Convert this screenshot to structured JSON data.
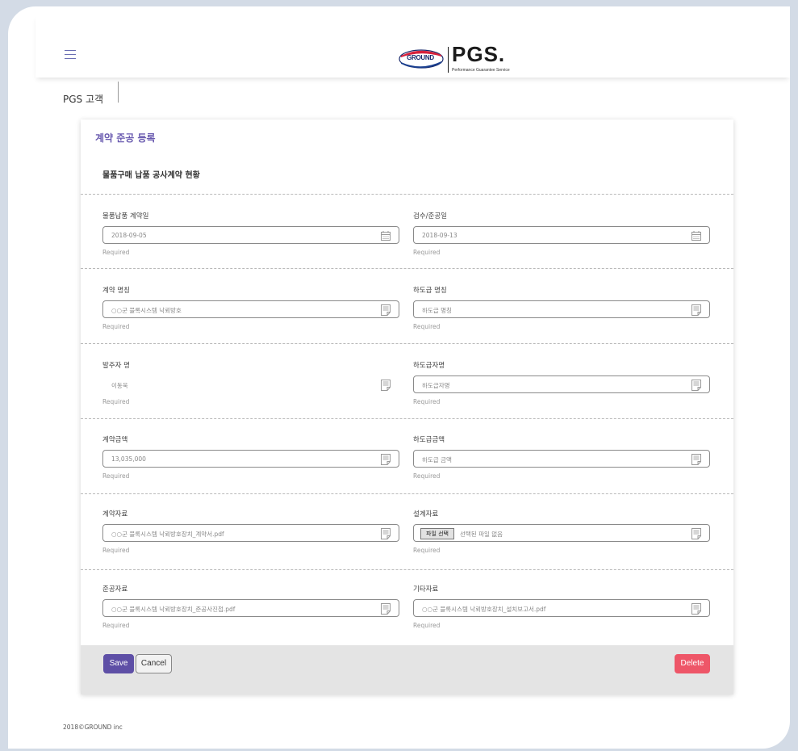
{
  "header": {
    "logo_ground": "GROUND",
    "logo_pgs": "PGS.",
    "logo_sub": "Performance Guarantee Service"
  },
  "breadcrumb": "PGS 고객",
  "card": {
    "title": "계약 준공 등록",
    "subtitle": "물품구매 납품 공사계약 현황"
  },
  "fields": {
    "contract_date": {
      "label": "물품납품 계약일",
      "value": "2018-09-05",
      "hint": "Required"
    },
    "inspection_date": {
      "label": "검수/준공일",
      "value": "2018-09-13",
      "hint": "Required"
    },
    "contract_name": {
      "label": "계약 명칭",
      "value": "○○군 블록시스템 낙뢰방호",
      "hint": "Required"
    },
    "subcontract_name": {
      "label": "하도급 명칭",
      "placeholder": "하도급 명칭",
      "hint": "Required"
    },
    "client_name": {
      "label": "발주자 명",
      "value": "이동욱",
      "hint": "Required"
    },
    "subcontractor_name": {
      "label": "하도급자명",
      "placeholder": "하도급자명",
      "hint": "Required"
    },
    "contract_amount": {
      "label": "계약금액",
      "value": "13,035,000",
      "hint": "Required"
    },
    "subcontract_amount": {
      "label": "하도급금액",
      "placeholder": "하도급 금액",
      "hint": "Required"
    },
    "contract_docs": {
      "label": "계약자료",
      "value": "○○군 블록시스템 낙뢰방호장치_계약서.pdf",
      "hint": "Required"
    },
    "design_docs": {
      "label": "설계자료",
      "button": "파일 선택",
      "status": "선택된 파일 없음",
      "hint": "Required"
    },
    "completion_docs": {
      "label": "준공자료",
      "value": "○○군 블록시스템 낙뢰방호장치_준공사진첩.pdf",
      "hint": "Required"
    },
    "other_docs": {
      "label": "기타자료",
      "value": "○○군 블록시스템 낙뢰방호장치_설치보고서.pdf",
      "hint": "Required"
    }
  },
  "actions": {
    "save": "Save",
    "cancel": "Cancel",
    "delete": "Delete"
  },
  "footer": {
    "copyright": "2018©GROUND inc"
  },
  "colors": {
    "accent": "#5e4fa6",
    "title": "#6a5bb0",
    "danger": "#ee5668",
    "background": "#d3dbe6"
  },
  "icons": {
    "menu": "hamburger-icon",
    "date": "calendar-icon",
    "text": "document-icon"
  }
}
